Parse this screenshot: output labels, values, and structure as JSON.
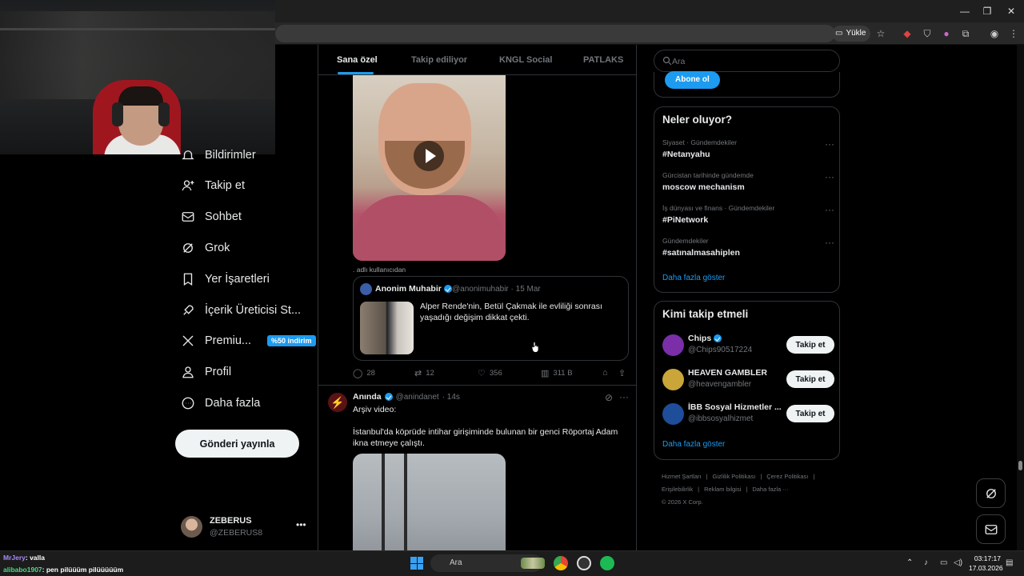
{
  "browser": {
    "upload_label": "Yükle",
    "window_controls": [
      "minimize-icon",
      "restore-icon",
      "close-icon"
    ]
  },
  "nav": {
    "items": [
      {
        "label": "Bildirimler",
        "icon": "bell-icon"
      },
      {
        "label": "Takip et",
        "icon": "person-add-icon"
      },
      {
        "label": "Sohbet",
        "icon": "mail-icon"
      },
      {
        "label": "Grok",
        "icon": "grok-icon"
      },
      {
        "label": "Yer İşaretleri",
        "icon": "bookmark-icon"
      },
      {
        "label": "İçerik Üreticisi St...",
        "icon": "rocket-icon"
      },
      {
        "label": "Premiu...",
        "icon": "x-logo-icon",
        "badge": "%50 indirim"
      },
      {
        "label": "Profil",
        "icon": "person-icon"
      },
      {
        "label": "Daha fazla",
        "icon": "more-circle-icon"
      }
    ],
    "post_button": "Gönderi yayınla",
    "account": {
      "name": "ZEBERUS",
      "handle": "@ZEBERUS8",
      "more": "•••"
    }
  },
  "main": {
    "tabs": [
      "Sana özel",
      "Takip ediliyor",
      "KNGL Social",
      "PATLAKS"
    ],
    "active_tab": "Sana özel",
    "tweet1": {
      "source_label": ". adlı kullanıcıdan",
      "quote": {
        "name": "Anonim Muhabir",
        "handle": "@anonimuhabir",
        "date": "· 15 Mar",
        "text": "Alper Rende'nin, Betül Çakmak ile evliliği sonrası yaşadığı değişim dikkat çekti."
      },
      "replies": "28",
      "retweets": "12",
      "likes": "356",
      "views": "311 B"
    },
    "tweet2": {
      "name": "Anında",
      "handle": "@anindanet",
      "time": "· 14s",
      "line1": "Arşiv video:",
      "line2": "İstanbul'da köprüde intihar girişiminde bulunan bir genci Röportaj Adam ikna etmeye çalıştı."
    }
  },
  "sidebar": {
    "search_placeholder": "Ara",
    "subscribe_label": "Abone ol",
    "trends_title": "Neler oluyor?",
    "trends": [
      {
        "category": "Siyaset · Gündemdekiler",
        "name": "#Netanyahu"
      },
      {
        "category": "Gürcistan tarihinde gündemde",
        "name": "moscow mechanism"
      },
      {
        "category": "İş dünyası ve finans · Gündemdekiler",
        "name": "#PiNetwork"
      },
      {
        "category": "Gündemdekiler",
        "name": "#satınalmasahiplen"
      }
    ],
    "trends_more": "Daha fazla göster",
    "who_title": "Kimi takip etmeli",
    "who": [
      {
        "name": "Chips",
        "handle": "@Chips90517224",
        "verified": true,
        "button": "Takip et",
        "color": "#7a2ea8"
      },
      {
        "name": "HEAVEN GAMBLER",
        "handle": "@heavengambler",
        "verified": false,
        "button": "Takip et",
        "color": "#c9a53a"
      },
      {
        "name": "İBB Sosyal Hizmetler ...",
        "handle": "@ibbsosyalhizmet",
        "verified": false,
        "button": "Takip et",
        "color": "#1e4d9a"
      }
    ],
    "who_more": "Daha fazla göster",
    "footer": [
      "Hizmet Şartları",
      "|",
      "Gizlilik Politikası",
      "|",
      "Çerez Politikası",
      "|",
      "Erişilebilirlik",
      "|",
      "Reklam bilgisi",
      "|",
      "Daha fazla ···",
      "© 2026 X Corp."
    ]
  },
  "stream_chat": [
    {
      "user": "MrJery",
      "msg": ": valla"
    },
    {
      "user": "alibabo1907",
      "msg": ": pen pilüüüm pilüüüüüm"
    }
  ],
  "taskbar": {
    "search": "Ara",
    "time": "03:17:17",
    "date": "17.03.2026"
  }
}
